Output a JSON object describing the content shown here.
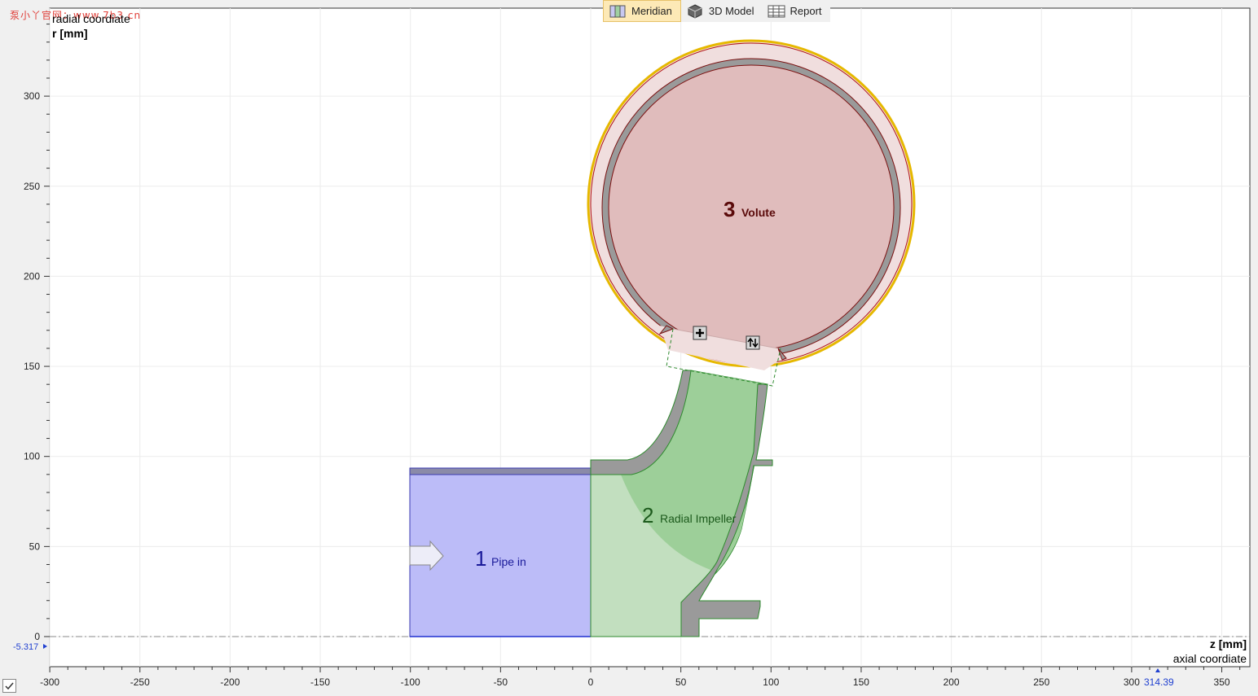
{
  "watermark": "泵小丫官网：www.7b3.cn",
  "tabs": [
    {
      "label": "Meridian",
      "icon": "meridian-icon",
      "active": true
    },
    {
      "label": "3D Model",
      "icon": "cube-icon",
      "active": false
    },
    {
      "label": "Report",
      "icon": "table-icon",
      "active": false
    }
  ],
  "axes": {
    "y_title_line1": "radial coordiate",
    "y_title_line2": "r [mm]",
    "x_title_line1": "z [mm]",
    "x_title_line2": "axial coordiate",
    "x_ticks": [
      -300,
      -250,
      -200,
      -150,
      -100,
      -50,
      0,
      50,
      100,
      150,
      200,
      250,
      300,
      350
    ],
    "y_ticks": [
      0,
      50,
      100,
      150,
      200,
      250,
      300
    ],
    "x_marker": "314.39",
    "y_marker": "-5.317"
  },
  "components": [
    {
      "number": "1",
      "label": "Pipe in",
      "color": "#1a1a9a"
    },
    {
      "number": "2",
      "label": "Radial Impeller",
      "color": "#1c5a1c"
    },
    {
      "number": "3",
      "label": "Volute",
      "color": "#5a0a0a"
    }
  ],
  "colors": {
    "plot_bg": "#ffffff",
    "grid": "#ececec",
    "pipe_fill": "#bcbcf8",
    "impeller_fill": "#c2dfbf",
    "impeller_dark": "#9dcf99",
    "wall_gray": "#9a9a9a",
    "volute_fill": "#e0bcbc",
    "volute_outer": "#f0dede"
  }
}
